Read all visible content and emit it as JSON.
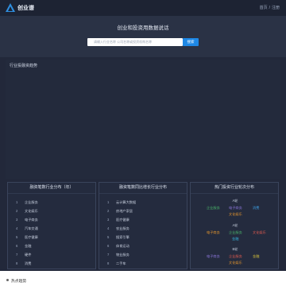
{
  "header": {
    "logo_text": "创业谱",
    "links": [
      "首页",
      "/",
      "注册"
    ]
  },
  "hero": {
    "title": "创业和投资用数据说话",
    "search_placeholder": "请输入行业名称 公司名称或投资机构名称",
    "search_button": "搜索"
  },
  "trend": {
    "title": "行业投融资趋势"
  },
  "panel_industry": {
    "title": "融资笔数行业分布（年）",
    "items": [
      {
        "n": "1",
        "label": "企业服务"
      },
      {
        "n": "2",
        "label": "文化娱乐"
      },
      {
        "n": "3",
        "label": "电子商务"
      },
      {
        "n": "4",
        "label": "汽车交通"
      },
      {
        "n": "5",
        "label": "医疗健康"
      },
      {
        "n": "6",
        "label": "金融"
      },
      {
        "n": "7",
        "label": "硬件"
      },
      {
        "n": "8",
        "label": "消费"
      }
    ]
  },
  "panel_growth": {
    "title": "融资笔数同比增长行业分布",
    "items": [
      {
        "n": "1",
        "label": "云计算大数据"
      },
      {
        "n": "2",
        "label": "房地产家居"
      },
      {
        "n": "3",
        "label": "医疗健康"
      },
      {
        "n": "4",
        "label": "农业服务"
      },
      {
        "n": "5",
        "label": "搜索引擎"
      },
      {
        "n": "6",
        "label": "体育运动"
      },
      {
        "n": "7",
        "label": "物业服务"
      },
      {
        "n": "8",
        "label": "二手车"
      }
    ]
  },
  "panel_rounds": {
    "title": "热门投资行业轮次分布",
    "stages": [
      {
        "name": "A轮",
        "industries": [
          "企业服务",
          "电子商务",
          "消费",
          "文化娱乐"
        ]
      },
      {
        "name": "A轮",
        "industries": [
          "电子商务",
          "企业服务",
          "文化娱乐",
          "金融"
        ]
      },
      {
        "name": "B轮",
        "industries": [
          "电子商务",
          "企业服务",
          "金融",
          "文化娱乐"
        ]
      }
    ]
  },
  "hot": {
    "title": "热点趋势"
  }
}
